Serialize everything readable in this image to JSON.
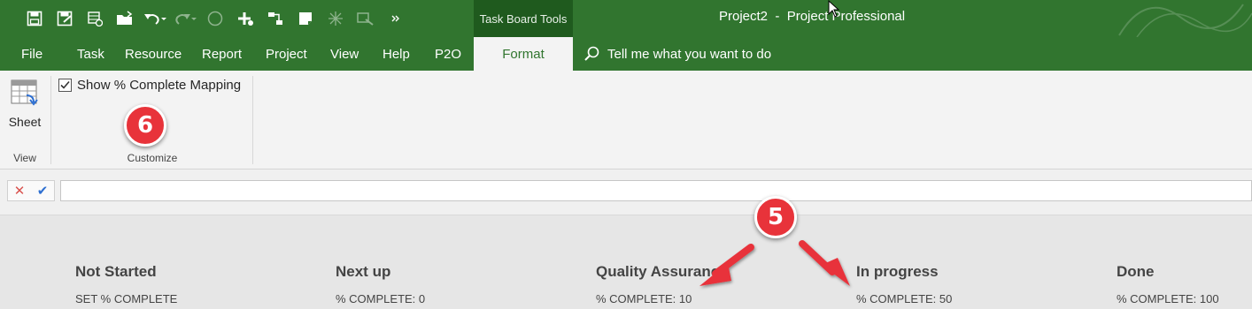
{
  "title_bar": {
    "context_tab": "Task Board Tools",
    "app_title": "Project2  -  Project Professional",
    "quick_access": [
      "save-icon",
      "save-baseline-icon",
      "new-task-icon",
      "open-folder-icon",
      "undo-icon",
      "redo-icon",
      "circle-icon",
      "add-icon",
      "link-icon",
      "note-icon",
      "split-icon",
      "move-icon",
      "more-icon"
    ]
  },
  "ribbon_tabs": {
    "file": "File",
    "task": "Task",
    "resource": "Resource",
    "report": "Report",
    "project": "Project",
    "view": "View",
    "help": "Help",
    "p2o": "P2O",
    "format": "Format",
    "tell_me": "Tell me what you want to do"
  },
  "ribbon": {
    "sheet_label": "Sheet",
    "view_group_label": "View",
    "show_complete_mapping": "Show % Complete Mapping",
    "show_complete_mapping_checked": true,
    "customize_group_label": "Customize"
  },
  "callouts": {
    "six": "6",
    "five": "5"
  },
  "board": {
    "columns": [
      {
        "title": "Not Started",
        "subtitle": "SET % COMPLETE"
      },
      {
        "title": "Next up",
        "subtitle": "% COMPLETE: 0"
      },
      {
        "title": "Quality Assurance",
        "subtitle": "% COMPLETE: 10"
      },
      {
        "title": "In progress",
        "subtitle": "% COMPLETE: 50"
      },
      {
        "title": "Done",
        "subtitle": "% COMPLETE: 100"
      }
    ]
  },
  "colors": {
    "title_bar": "#31752f",
    "context_tab": "#1f5a1e",
    "ribbon": "#f3f3f3",
    "callout": "#e8333a",
    "cancel": "#d9534f",
    "enter": "#2e6fd1"
  }
}
